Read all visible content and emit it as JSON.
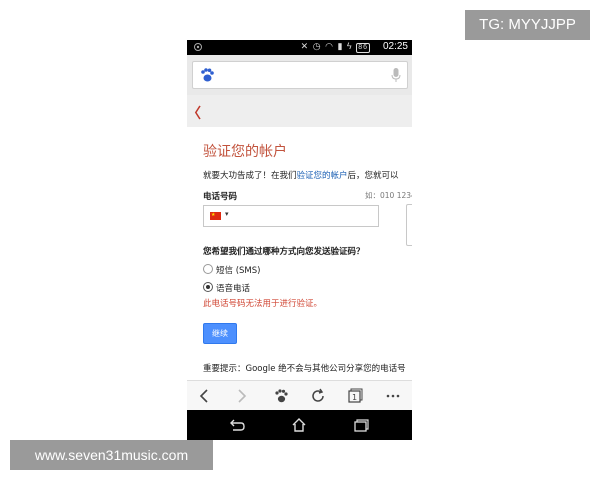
{
  "watermarks": {
    "tg": "TG: MYYJJPP",
    "site": "www.seven31music.com"
  },
  "statusbar": {
    "battery": "86",
    "time": "02:25"
  },
  "page": {
    "title": "验证您的帐户",
    "intro_before": "就要大功告成了！在我们",
    "intro_link": "验证您的帐户",
    "intro_after": "后，您就可以",
    "phone_label": "电话号码",
    "phone_hint": "如：010 1234",
    "country": "China",
    "question": "您希望我们通过哪种方式向您发送验证码？",
    "options": [
      {
        "label": "短信 (SMS)",
        "selected": false
      },
      {
        "label": "语音电话",
        "selected": true
      }
    ],
    "error": "此电话号码无法用于进行验证。",
    "continue_button": "继续",
    "note": "重要提示：Google 绝不会与其他公司分享您的电话号"
  },
  "icons": {
    "urlbar": [
      "baidu-paw-icon",
      "microphone-icon"
    ],
    "browser_toolbar": [
      "back-icon",
      "forward-icon",
      "baidu-paw-icon",
      "refresh-icon",
      "tabs-icon",
      "more-icon"
    ],
    "tabs_count": "1",
    "nav": [
      "back-icon",
      "home-icon",
      "recent-apps-icon"
    ]
  },
  "colors": {
    "title": "#c2533d",
    "error": "#d14836",
    "button": "#4d90fe",
    "link": "#1a5fb4"
  }
}
